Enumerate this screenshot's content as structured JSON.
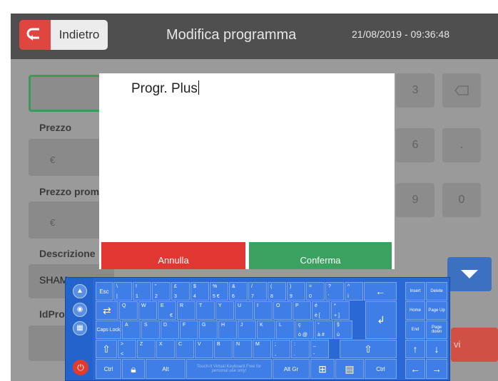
{
  "header": {
    "back_label": "Indietro",
    "title": "Modifica programma",
    "datetime": "21/08/2019 - 09:36:48"
  },
  "form": {
    "price_label": "Prezzo",
    "promo_label": "Prezzo promoz",
    "description_label": "Descrizione",
    "description_value": "SHAM",
    "id_label": "IdPro",
    "currency": "€"
  },
  "numpad": {
    "keys": [
      "3",
      "6",
      ".",
      "9",
      "0"
    ]
  },
  "dialog": {
    "input_value": "Progr. Plus",
    "cancel_label": "Annulla",
    "confirm_label": "Conferma"
  },
  "side_button": {
    "partial_label": "vi"
  },
  "keyboard": {
    "row1": [
      {
        "t": "\\",
        "b": "|"
      },
      {
        "t": "!",
        "b": "1"
      },
      {
        "t": "\"",
        "b": "2"
      },
      {
        "t": "£",
        "b": "3"
      },
      {
        "t": "$",
        "b": "4"
      },
      {
        "t": "%",
        "b": "5 €"
      },
      {
        "t": "&",
        "b": "6"
      },
      {
        "t": "/",
        "b": "7"
      },
      {
        "t": "(",
        "b": "8"
      },
      {
        "t": ")",
        "b": "9"
      },
      {
        "t": "=",
        "b": "0"
      },
      {
        "t": "?",
        "b": "'"
      },
      {
        "t": "^",
        "b": "ì"
      }
    ],
    "row2_letters": [
      "Q",
      "W",
      "E",
      "R",
      "T",
      "Y",
      "U",
      "I",
      "O",
      "P"
    ],
    "row2_extra": [
      {
        "t": "é",
        "b": "è [",
        "r": ""
      },
      {
        "t": "*",
        "b": "+ ]",
        "r": ""
      }
    ],
    "row2_euro": "€",
    "row3_letters": [
      "A",
      "S",
      "D",
      "F",
      "G",
      "H",
      "J",
      "K",
      "L"
    ],
    "row3_extra": [
      {
        "t": "ç",
        "b": "ò @"
      },
      {
        "t": "°",
        "b": "à #"
      },
      {
        "t": "§",
        "b": "ù"
      }
    ],
    "row4_letters": [
      "Z",
      "X",
      "C",
      "V",
      "B",
      "N",
      "M"
    ],
    "row4_lt": {
      "t": ">",
      "b": "<"
    },
    "row4_punct": [
      {
        "t": ";",
        "b": ","
      },
      {
        "t": ":",
        "b": "."
      },
      {
        "t": "_",
        "b": "-"
      }
    ],
    "esc": "Esc",
    "caps": "Caps Lock",
    "ctrl": "Ctrl",
    "alt": "Alt",
    "altgr": "Alt Gr",
    "spacebar_text": "Touch-It Virtual Keyboard Free for personal use only!",
    "nav": {
      "insert": "Insert",
      "delete": "Delete",
      "home": "Home",
      "page_up": "Page Up",
      "end": "End",
      "page_down": "Page down"
    }
  }
}
